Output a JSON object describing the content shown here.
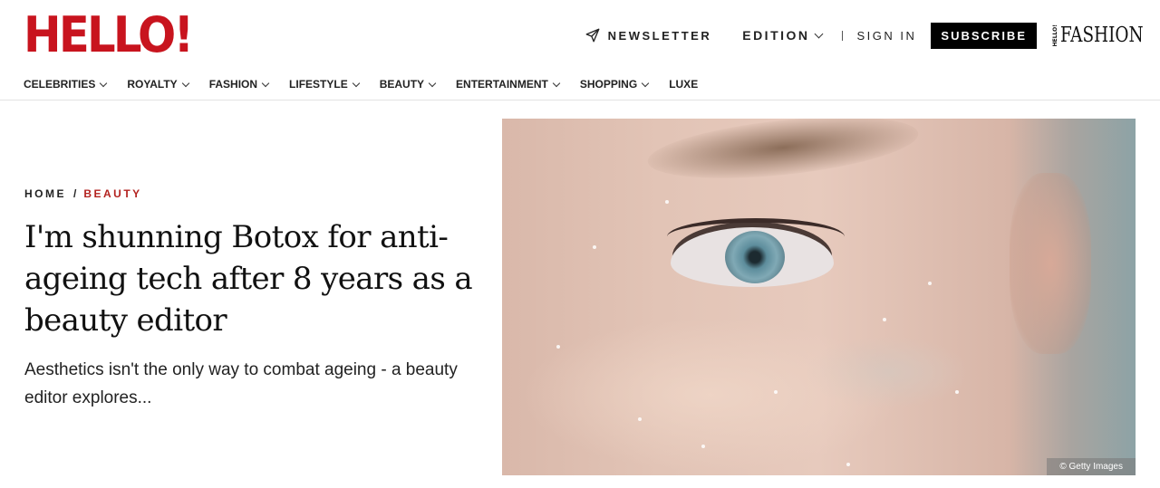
{
  "brand": {
    "logo": "HELLO!",
    "fashion_mini": "HELLO!",
    "fashion_word": "FASHION"
  },
  "topbar": {
    "newsletter": "NEWSLETTER",
    "edition": "EDITION",
    "signin": "SIGN IN",
    "subscribe": "SUBSCRIBE"
  },
  "nav": [
    {
      "label": "CELEBRITIES",
      "dropdown": true
    },
    {
      "label": "ROYALTY",
      "dropdown": true
    },
    {
      "label": "FASHION",
      "dropdown": true
    },
    {
      "label": "LIFESTYLE",
      "dropdown": true
    },
    {
      "label": "BEAUTY",
      "dropdown": true
    },
    {
      "label": "ENTERTAINMENT",
      "dropdown": true
    },
    {
      "label": "SHOPPING",
      "dropdown": true
    },
    {
      "label": "LUXE",
      "dropdown": false
    }
  ],
  "article": {
    "breadcrumb": {
      "home": "HOME",
      "separator": "/",
      "category": "BEAUTY"
    },
    "headline": "I'm shunning Botox for anti-ageing tech after 8 years as a beauty editor",
    "standfirst": "Aesthetics isn't the only way to combat ageing - a beauty editor explores...",
    "image_credit": "© Getty Images"
  },
  "colors": {
    "brand_red": "#c8141e",
    "category_red": "#b3221f",
    "subscribe_bg": "#000000"
  },
  "icons": {
    "newsletter": "paper-plane-icon",
    "dropdown": "chevron-down-icon"
  }
}
